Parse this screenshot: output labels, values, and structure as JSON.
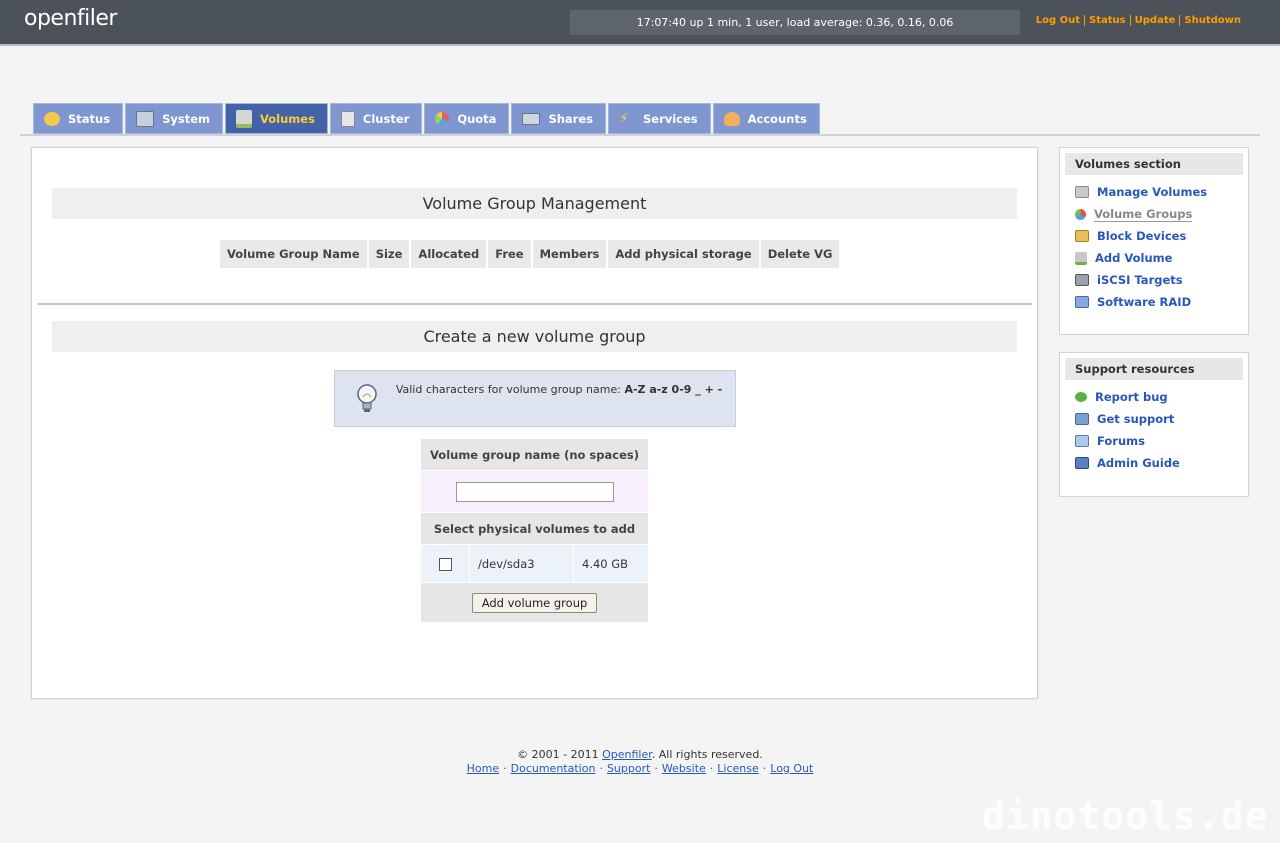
{
  "header": {
    "logo": "openfiler",
    "uptime": "17:07:40 up 1 min, 1 user, load average: 0.36, 0.16, 0.06",
    "links": [
      "Log Out",
      "Status",
      "Update",
      "Shutdown"
    ]
  },
  "tabs": [
    {
      "label": "Status",
      "icon": "weather-sun-icon",
      "color": "#f2c94c"
    },
    {
      "label": "System",
      "icon": "monitor-icon",
      "color": "#c8d0dc"
    },
    {
      "label": "Volumes",
      "icon": "drive-icon",
      "color": "#8fbf60",
      "active": true
    },
    {
      "label": "Cluster",
      "icon": "server-cluster-icon",
      "color": "#d9d9d9"
    },
    {
      "label": "Quota",
      "icon": "pie-chart-icon",
      "color": "#e06060"
    },
    {
      "label": "Shares",
      "icon": "network-drive-icon",
      "color": "#cfd6e0"
    },
    {
      "label": "Services",
      "icon": "lightning-icon",
      "color": "#ffd23f"
    },
    {
      "label": "Accounts",
      "icon": "users-icon",
      "color": "#f0b060"
    }
  ],
  "main": {
    "vg_title": "Volume Group Management",
    "vg_columns": [
      "Volume Group Name",
      "Size",
      "Allocated",
      "Free",
      "Members",
      "Add physical storage",
      "Delete VG"
    ],
    "create_title": "Create a new volume group",
    "tip_prefix": "Valid characters for volume group name:",
    "tip_chars": "A-Z a-z 0-9 _ + -",
    "name_label": "Volume group name (no spaces)",
    "name_value": "",
    "pv_label": "Select physical volumes to add",
    "physical_volumes": [
      {
        "device": "/dev/sda3",
        "size": "4.40 GB",
        "checked": false
      }
    ],
    "submit_label": "Add volume group"
  },
  "sidebar": {
    "volumes": {
      "title": "Volumes section",
      "items": [
        {
          "label": "Manage Volumes",
          "icon": "disk-icon"
        },
        {
          "label": "Volume Groups",
          "icon": "group-icon",
          "current": true
        },
        {
          "label": "Block Devices",
          "icon": "block-device-icon"
        },
        {
          "label": "Add Volume",
          "icon": "add-disk-icon"
        },
        {
          "label": "iSCSI Targets",
          "icon": "iscsi-icon"
        },
        {
          "label": "Software RAID",
          "icon": "raid-icon"
        }
      ]
    },
    "support": {
      "title": "Support resources",
      "items": [
        {
          "label": "Report bug",
          "icon": "bug-icon"
        },
        {
          "label": "Get support",
          "icon": "support-icon"
        },
        {
          "label": "Forums",
          "icon": "forum-icon"
        },
        {
          "label": "Admin Guide",
          "icon": "book-icon"
        }
      ]
    }
  },
  "footer": {
    "copyright_prefix": "© 2001 - 2011",
    "brand": "Openfiler",
    "copyright_suffix": ". All rights reserved.",
    "links": [
      "Home",
      "Documentation",
      "Support",
      "Website",
      "License",
      "Log Out"
    ]
  },
  "watermark": "dinotools.de"
}
